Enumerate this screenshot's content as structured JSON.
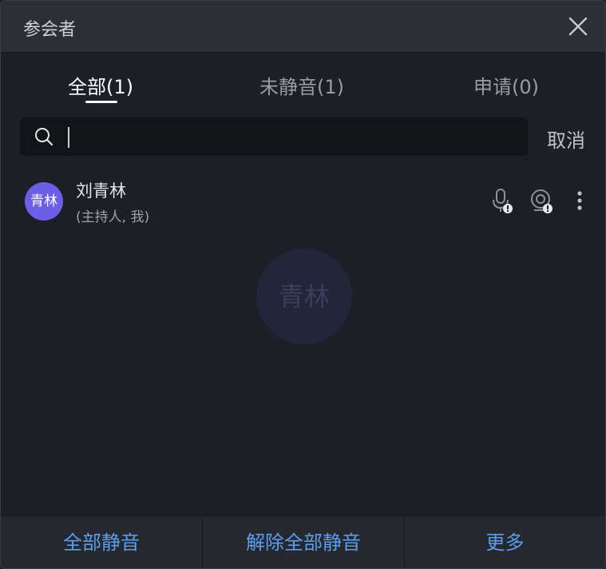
{
  "window": {
    "title": "参会者"
  },
  "tabs": [
    {
      "label": "全部(1)",
      "active": true
    },
    {
      "label": "未静音(1)",
      "active": false
    },
    {
      "label": "申请(0)",
      "active": false
    }
  ],
  "search": {
    "value": "",
    "cancel_label": "取消"
  },
  "participants": [
    {
      "avatar_text": "青林",
      "name": "刘青林",
      "role": "(主持人, 我)",
      "avatar_color": "#6b5fe8",
      "mic_icon": "mic-warning-icon",
      "camera_icon": "camera-warning-icon",
      "more_icon": "more-vertical-icon"
    }
  ],
  "watermark": {
    "avatar_text": "青林"
  },
  "footer": {
    "mute_all_label": "全部静音",
    "unmute_all_label": "解除全部静音",
    "more_label": "更多"
  },
  "colors": {
    "accent": "#5b9ef0",
    "avatar": "#6b5fe8",
    "background": "#1c1f25",
    "titlebar": "#2c2f34"
  }
}
